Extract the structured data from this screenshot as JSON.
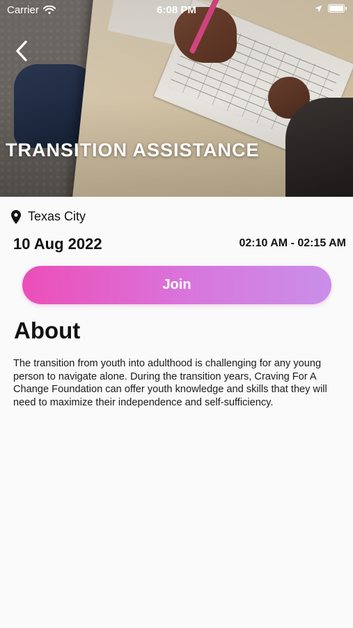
{
  "status_bar": {
    "carrier": "Carrier",
    "time": "6:08 PM"
  },
  "event": {
    "title": "TRANSITION ASSISTANCE",
    "location": "Texas City",
    "date": "10 Aug 2022",
    "time_range": "02:10 AM - 02:15 AM",
    "join_label": "Join"
  },
  "about": {
    "heading": "About",
    "body": "The transition from youth into adulthood is challenging for any young person to navigate alone. During the transition years, Craving For A Change Foundation can offer youth knowledge and skills that they will need to maximize their independence and self-sufficiency."
  },
  "icons": {
    "back": "chevron-left-icon",
    "location": "location-pin-icon",
    "wifi": "wifi-icon",
    "location_arrow": "location-arrow-icon",
    "battery": "battery-icon"
  },
  "colors": {
    "join_gradient_start": "#ec4eb8",
    "join_gradient_end": "#c98fe8",
    "background": "#fafafa"
  }
}
